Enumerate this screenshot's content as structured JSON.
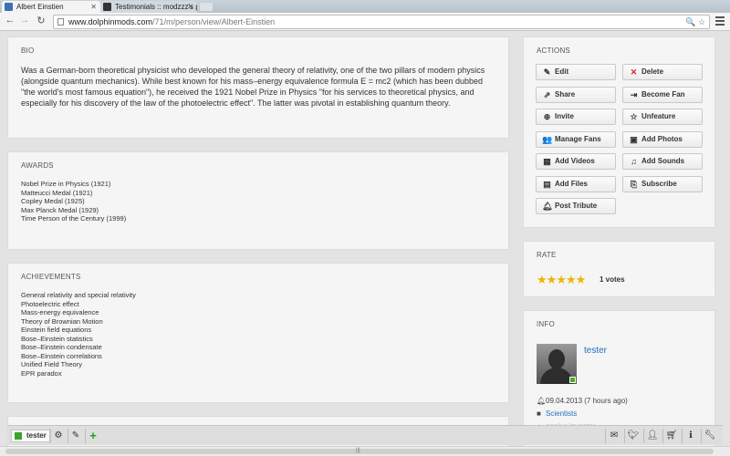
{
  "browser": {
    "tabs": [
      {
        "title": "Albert Einstien",
        "active": true
      },
      {
        "title": "Testimonials :: modzzz's p",
        "active": false
      }
    ],
    "url_host": "www.dolphinmods.com",
    "url_path": "/71/m/person/view/Albert-Einstien"
  },
  "bio": {
    "title": "BIO",
    "text": "Was a German-born theoretical physicist who developed the general theory of relativity, one of the two pillars of modern physics (alongside quantum mechanics). While best known for his mass–energy equivalence formula E = mc2 (which has been dubbed \"the world's most famous equation\"), he received the 1921 Nobel Prize in Physics \"for his services to theoretical physics, and especially for his discovery of the law of the photoelectric effect\". The latter was pivotal in establishing quantum theory."
  },
  "awards": {
    "title": "AWARDS",
    "items": [
      "Nobel Prize in Physics (1921)",
      "Matteucci Medal (1921)",
      "Copley Medal (1925)",
      "Max Planck Medal (1929)",
      "Time Person of the Century (1999)"
    ]
  },
  "achievements": {
    "title": "ACHIEVEMENTS",
    "items": [
      "General relativity and special relativity",
      "Photoelectric effect",
      "Mass-energy equivalence",
      "Theory of Brownian Motion",
      "Einstein field equations",
      "Bose–Einstein statistics",
      "Bose–Einstein condensate",
      "Bose–Einstein correlations",
      "Unified Field Theory",
      "EPR paradox"
    ]
  },
  "actions": {
    "title": "ACTIONS",
    "buttons": [
      {
        "label": "Edit",
        "icon": "edit-icon"
      },
      {
        "label": "Delete",
        "icon": "delete-icon"
      },
      {
        "label": "Share",
        "icon": "share-icon"
      },
      {
        "label": "Become Fan",
        "icon": "signin-icon"
      },
      {
        "label": "Invite",
        "icon": "plus-circle-icon"
      },
      {
        "label": "Unfeature",
        "icon": "star-outline-icon"
      },
      {
        "label": "Manage Fans",
        "icon": "group-icon"
      },
      {
        "label": "Add Photos",
        "icon": "picture-icon"
      },
      {
        "label": "Add Videos",
        "icon": "film-icon"
      },
      {
        "label": "Add Sounds",
        "icon": "music-icon"
      },
      {
        "label": "Add Files",
        "icon": "save-icon"
      },
      {
        "label": "Subscribe",
        "icon": "paperclip-icon"
      },
      {
        "label": "Post Tribute",
        "icon": "bell-icon"
      }
    ]
  },
  "rate": {
    "title": "RATE",
    "stars": 5,
    "votes_label": "1 votes"
  },
  "info": {
    "title": "INFO",
    "username": "tester",
    "date": "09.04.2013 (7 hours ago)",
    "category": "Scientists",
    "tag": "genius inventor"
  },
  "bottombar": {
    "username": "tester",
    "accent": "#3aa52a"
  }
}
